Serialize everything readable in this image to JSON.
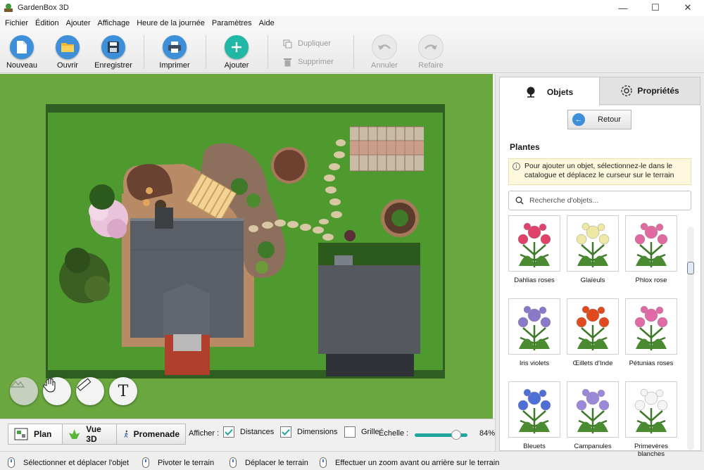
{
  "window": {
    "title": "GardenBox 3D",
    "minimize": "—",
    "maximize": "☐",
    "close": "✕"
  },
  "menu": [
    "Fichier",
    "Édition",
    "Ajouter",
    "Affichage",
    "Heure de la journée",
    "Paramètres",
    "Aide"
  ],
  "toolbar": {
    "new_label": "Nouveau",
    "open_label": "Ouvrir",
    "save_label": "Enregistrer",
    "print_label": "Imprimer",
    "add_label": "Ajouter",
    "duplicate_label": "Dupliquer",
    "delete_label": "Supprimer",
    "undo_label": "Annuler",
    "redo_label": "Refaire"
  },
  "canvas_tools": {
    "text_tool_glyph": "T"
  },
  "views": {
    "plan": "Plan",
    "view3d": "Vue 3D",
    "walk": "Promenade"
  },
  "display_options": {
    "label": "Afficher :",
    "distances": {
      "label": "Distances",
      "checked": true
    },
    "dimensions": {
      "label": "Dimensions",
      "checked": true
    },
    "grid": {
      "label": "Grille",
      "checked": false
    },
    "scale_label": "Échelle :",
    "zoom_percent": "84%",
    "zoom_fraction": 0.84
  },
  "status": {
    "select": "Sélectionner et déplacer l'objet",
    "rotate": "Pivoter le terrain",
    "move": "Déplacer le terrain",
    "zoom": "Effectuer un zoom avant ou arrière sur le terrain"
  },
  "panel": {
    "tab_objects": "Objets",
    "tab_properties": "Propriétés",
    "back_label": "Retour",
    "section_title": "Plantes",
    "hint": "Pour ajouter un objet, sélectionnez-le dans le catalogue et déplacez le curseur sur le terrain",
    "search_placeholder": "Recherche d'objets...",
    "plants": [
      {
        "name": "Dahlias roses",
        "color": "#e0426b"
      },
      {
        "name": "Glaïeuls",
        "color": "#efe7a4"
      },
      {
        "name": "Phlox rose",
        "color": "#e06aa0"
      },
      {
        "name": "Iris violets",
        "color": "#8a78c8"
      },
      {
        "name": "Œillets d'Inde",
        "color": "#e04a1c"
      },
      {
        "name": "Pétunias roses",
        "color": "#e06aa6"
      },
      {
        "name": "Bleuets",
        "color": "#4e6fd6"
      },
      {
        "name": "Campanules",
        "color": "#9c88d8"
      },
      {
        "name": "Primevères blanches",
        "color": "#f4f4f4"
      }
    ]
  },
  "colors": {
    "accent": "#1fa59a",
    "grass": "#6aa83f",
    "info_blue": "#3c8fd8"
  }
}
